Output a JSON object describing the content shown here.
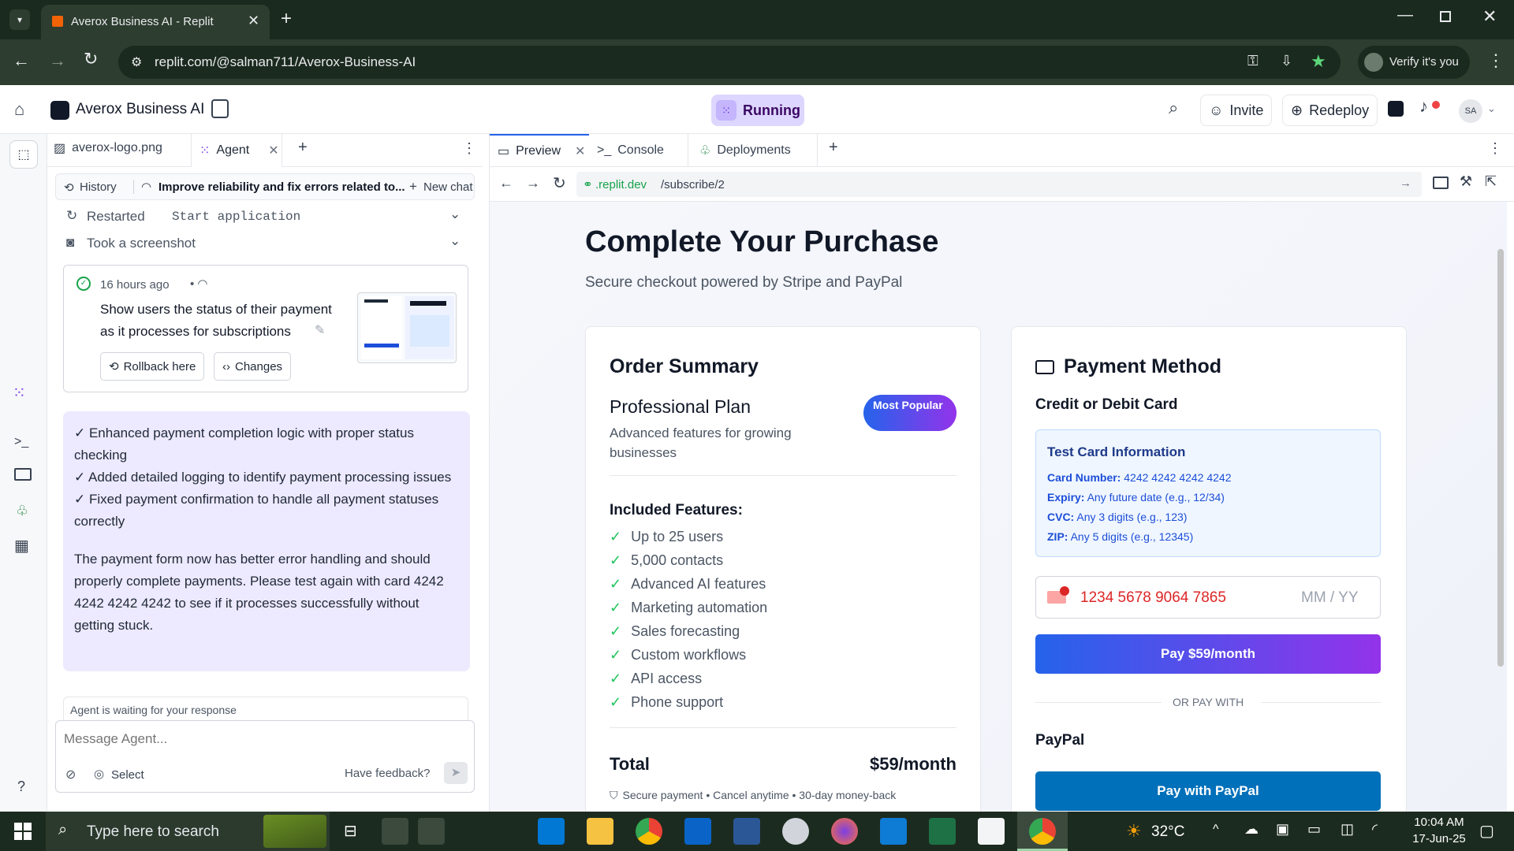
{
  "browser": {
    "tab_title": "Averox Business AI - Replit",
    "url": "replit.com/@salman711/Averox-Business-AI",
    "verify_label": "Verify it's you"
  },
  "header": {
    "project_name": "Averox Business AI",
    "status": "Running",
    "invite": "Invite",
    "redeploy": "Redeploy",
    "avatar": "SA"
  },
  "left_tabs": [
    {
      "label": "averox-logo.png"
    },
    {
      "label": "Agent"
    }
  ],
  "agent": {
    "history": "History",
    "thread_title": "Improve reliability and fix errors related to...",
    "new_chat": "New chat",
    "step1_prefix": "Restarted ",
    "step1_code": "Start application",
    "step2": "Took a screenshot",
    "checkpoint_time": "16 hours ago",
    "checkpoint_text": "Show users the status of their payment as it processes for subscriptions",
    "rollback": "Rollback here",
    "changes": "Changes",
    "msg_line1": "✓ Enhanced payment completion logic with proper status checking",
    "msg_line2": "✓ Added detailed logging to identify payment processing issues",
    "msg_line3": "✓ Fixed payment confirmation to handle all payment statuses correctly",
    "msg_para": "The payment form now has better error handling and should properly complete payments. Please test again with card 4242 4242 4242 4242 to see if it processes successfully without getting stuck.",
    "waiting": "Agent is waiting for your response",
    "input_placeholder": "Message Agent...",
    "select": "Select",
    "feedback": "Have feedback?"
  },
  "right_tabs": [
    {
      "label": "Preview"
    },
    {
      "label": "Console"
    },
    {
      "label": "Deployments"
    }
  ],
  "preview": {
    "url_domain": ".replit.dev",
    "url_path": "/subscribe/2",
    "title": "Complete Your Purchase",
    "subtitle": "Secure checkout powered by Stripe and PayPal",
    "order": {
      "heading": "Order Summary",
      "plan_name": "Professional Plan",
      "plan_desc": "Advanced features for growing businesses",
      "badge": "Most Popular",
      "features_heading": "Included Features:",
      "features": [
        "Up to 25 users",
        "5,000 contacts",
        "Advanced AI features",
        "Marketing automation",
        "Sales forecasting",
        "Custom workflows",
        "API access",
        "Phone support"
      ],
      "total_label": "Total",
      "total_value": "$59/month",
      "footer": "Secure payment • Cancel anytime • 30-day money-back"
    },
    "payment": {
      "heading": "Payment Method",
      "card_heading": "Credit or Debit Card",
      "test_heading": "Test Card Information",
      "card_number_label": "Card Number:",
      "card_number_value": "4242 4242 4242 4242",
      "expiry_label": "Expiry:",
      "expiry_value": "Any future date (e.g., 12/34)",
      "cvc_label": "CVC:",
      "cvc_value": "Any 3 digits (e.g., 123)",
      "zip_label": "ZIP:",
      "zip_value": "Any 5 digits (e.g., 12345)",
      "card_input_value": "1234 5678 9064 7865",
      "expiry_placeholder": "MM / YY",
      "pay_button": "Pay $59/month",
      "or_pay_with": "OR PAY WITH",
      "paypal_heading": "PayPal",
      "paypal_button": "Pay with PayPal"
    }
  },
  "taskbar": {
    "search_placeholder": "Type here to search",
    "temperature": "32°C",
    "time": "10:04 AM",
    "date": "17-Jun-25"
  },
  "colors": {
    "accent_purple": "#7c3aed",
    "pay_gradient_start": "#2563eb",
    "pay_gradient_end": "#9333ea",
    "paypal_blue": "#0070ba",
    "error_red": "#dc2626",
    "check_green": "#22c55e"
  }
}
